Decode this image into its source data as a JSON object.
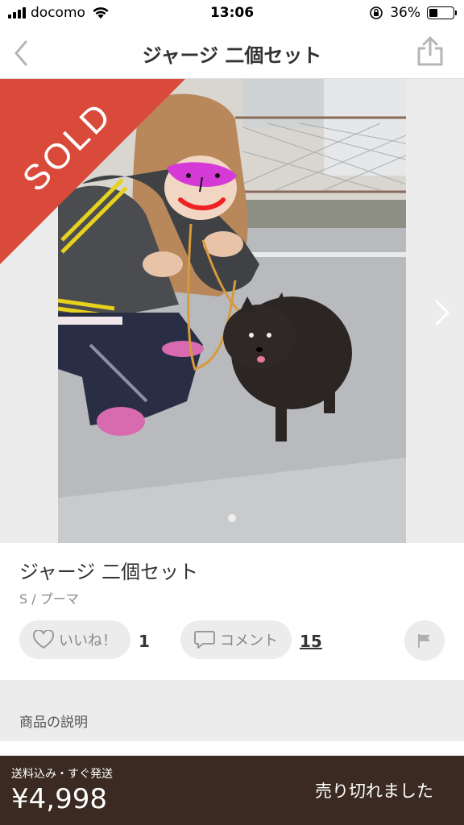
{
  "status_bar": {
    "carrier": "docomo",
    "time": "13:06",
    "battery_percent": "36%",
    "battery_level": 0.36
  },
  "nav": {
    "title": "ジャージ 二個セット",
    "back_icon": "chevron-left-icon",
    "share_icon": "share-icon"
  },
  "image": {
    "sold_label": "SOLD",
    "sold_color": "#d94a3a",
    "page_count": 1,
    "current_page": 1
  },
  "item": {
    "title": "ジャージ 二個セット",
    "meta": "S / プーマ"
  },
  "actions": {
    "like_label": "いいね！",
    "like_count": "1",
    "comment_label": "コメント",
    "comment_count": "15"
  },
  "description": {
    "header": "商品の説明"
  },
  "bottom_bar": {
    "shipping": "送料込み・すぐ発送",
    "price": "¥4,998",
    "status": "売り切れました",
    "background": "#3a2a21"
  }
}
